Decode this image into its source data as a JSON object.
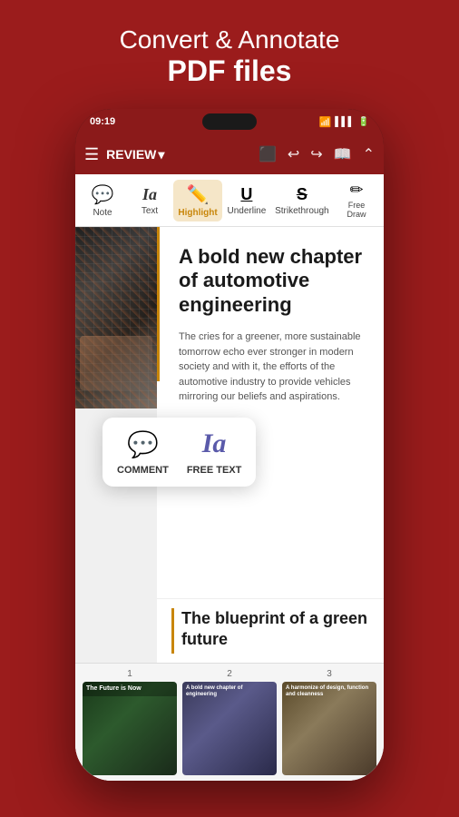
{
  "hero": {
    "line1": "Convert & Annotate",
    "line2": "PDF files"
  },
  "status_bar": {
    "time": "09:19",
    "icons": "wifi signal battery"
  },
  "toolbar": {
    "menu_icon": "☰",
    "title": "REVIEW",
    "dropdown_icon": "▾",
    "save_icon": "⬛",
    "undo_icon": "↩",
    "redo_icon": "↪",
    "bookmark_icon": "📖",
    "collapse_icon": "⌃"
  },
  "annotation_bar": {
    "items": [
      {
        "label": "Note",
        "icon": "💬",
        "active": false
      },
      {
        "label": "Text",
        "icon": "Ia",
        "active": false
      },
      {
        "label": "Highlight",
        "icon": "✏",
        "active": true
      },
      {
        "label": "Underline",
        "icon": "U̲",
        "active": false
      },
      {
        "label": "Strikethrough",
        "icon": "S̶",
        "active": false
      },
      {
        "label": "Free Draw",
        "icon": "✏",
        "active": false
      }
    ]
  },
  "document": {
    "title": "A bold new chapter of automotive engineering",
    "body": "The cries for a greener, more sustainable tomorrow echo ever stronger in modern society and with it, the efforts of the automotive industry to provide vehicles mirroring our beliefs and aspirations.",
    "blueprint_title": "The blueprint of a green future"
  },
  "popup": {
    "comment_label": "COMMENT",
    "freetext_label": "FREE TEXT"
  },
  "page_numbers": [
    "1",
    "2",
    "3"
  ]
}
